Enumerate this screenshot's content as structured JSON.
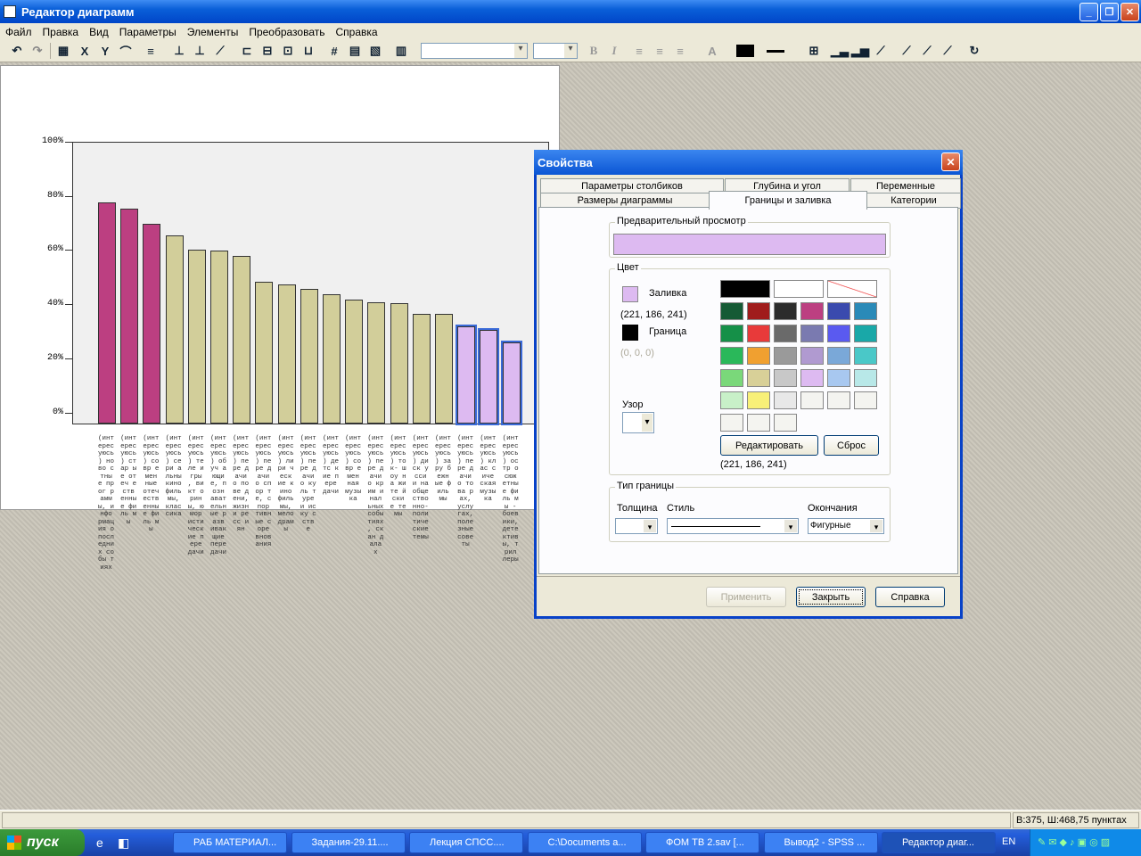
{
  "window": {
    "title": "Редактор диаграмм"
  },
  "menu": [
    "Файл",
    "Правка",
    "Вид",
    "Параметры",
    "Элементы",
    "Преобразовать",
    "Справка"
  ],
  "chart_data": {
    "type": "bar",
    "ylabel": "",
    "ylim": [
      0,
      100
    ],
    "yticks": [
      "100%",
      "80%",
      "60%",
      "40%",
      "20%",
      "0%"
    ],
    "values": [
      82,
      79.5,
      74,
      69.5,
      64.5,
      64,
      62,
      52.5,
      51.5,
      50,
      48,
      46,
      45,
      44.5,
      40.5,
      40.5,
      36,
      34.5,
      30
    ],
    "colors": [
      "#bc3f81",
      "#bc3f81",
      "#bc3f81",
      "#d2ce9a",
      "#d2ce9a",
      "#d2ce9a",
      "#d2ce9a",
      "#d2ce9a",
      "#d2ce9a",
      "#d2ce9a",
      "#d2ce9a",
      "#d2ce9a",
      "#d2ce9a",
      "#d2ce9a",
      "#d2ce9a",
      "#d2ce9a",
      "#ddbaf1",
      "#ddbaf1",
      "#ddbaf1"
    ],
    "selected": [
      16,
      17,
      18
    ],
    "categories": [
      "(инт ерес уюсь ) ново стны е прог рамм ы, инфо рмац ия о посл едни х собы тиях",
      "(инт ерес уюсь ) стар ые отеч еств енны е филь мы",
      "(инт ерес уюсь ) совр емен ные отеч еств енны е филь мы",
      "(инт ерес уюсь ) сери альны кино филь мы, клас сика",
      "(инт ерес уюсь ) теле игры , викт орин ы, юмор исти ческ ие пере дачи",
      "(инт ерес уюсь ) обуч ающи е, позн ават ельн ые разв ивак щие пере дачи",
      "(инт ерес уюсь ) пере дачи о пове дени, жизн и ресс иян",
      "(инт ерес уюсь ) пере дачи о спор те, спор тивн ые соре внов ания",
      "(инт ерес уюсь ) лири ческ ие кино филь мы, мело драм ы",
      "(инт ерес уюсь ) пере дачи о куль туре и иску сств е",
      "(инт ерес уюсь ) детс кие пере дачи",
      "(инт ерес уюсь ) совр емен ная музы ка",
      "(инт ерес уюсь ) пере дачи о крим инал ьных собы тиях , скан дала х",
      "(инт ерес уюсь ) ток- шоу на жите йски е темы",
      "(инт ерес уюсь ) диск усси и на обще ство нно- поли тиче ские темы",
      "(инт ерес уюсь ) зару бежн ые филь мы",
      "(инт ерес уюсь ) пере дачи о това рах, услу гах, поле зные сове ты",
      "(инт ерес уюсь ) клас сиче ская музы ка",
      "(инт ерес уюсь ) остр осюж етны е филь мы - боев ики, дете ктив ы, трил леры"
    ]
  },
  "dialog": {
    "title": "Свойства",
    "tabs_back": [
      "Параметры столбиков",
      "Глубина и угол",
      "Переменные"
    ],
    "tabs_front": [
      "Размеры диаграммы",
      "Границы и заливка",
      "Категории"
    ],
    "preview_label": "Предварительный просмотр",
    "preview_color": "#ddbaf1",
    "color_group": "Цвет",
    "fill_label": "Заливка",
    "fill_rgb": "(221, 186, 241)",
    "border_label": "Граница",
    "border_rgb": "(0, 0, 0)",
    "pattern_label": "Узор",
    "edit_btn": "Редактировать",
    "reset_btn": "Сброс",
    "current_rgb": "(221, 186, 241)",
    "border_group": "Тип границы",
    "thickness_label": "Толщина",
    "style_label": "Стиль",
    "ends_label": "Окончания",
    "ends_value": "Фигурные",
    "apply_btn": "Применить",
    "close_btn": "Закрыть",
    "help_btn": "Справка",
    "palette": [
      "#000000",
      "#ffffff",
      "none",
      "#7b2b7e",
      "#2b2b6e",
      "#1f5f7a",
      "#155a35",
      "#a01c1c",
      "#2c2c2c",
      "#bc3f81",
      "#3a4aae",
      "#2a8ab8",
      "#159048",
      "#e83a3a",
      "#6a6a6a",
      "#7a7ab0",
      "#5a5af0",
      "#19a8a8",
      "#2ab85a",
      "#f0a030",
      "#9a9a9a",
      "#b09ad0",
      "#7aa8d8",
      "#4ac8c8",
      "#7ad87a",
      "#d8d098",
      "#c8c8c8",
      "#ddbaf1",
      "#a8c8f0",
      "#b8e8e8",
      "#c8f0c8",
      "#f8f078",
      "#e8e8e8",
      "#f4f4f0",
      "#f4f4f0",
      "#f4f4f0",
      "#f4f4f0",
      "#f4f4f0",
      "#f4f4f0"
    ]
  },
  "status": "В:375, Ш:468,75 пунктах",
  "taskbar": {
    "start": "пуск",
    "tasks": [
      "РАБ МАТЕРИАЛ...",
      "Задания-29.11....",
      "Лекция СПСС....",
      "C:\\Documents a...",
      "ФОМ ТВ 2.sav [...",
      "Вывод2 - SPSS ...",
      "Редактор диаг..."
    ],
    "lang": "EN"
  }
}
